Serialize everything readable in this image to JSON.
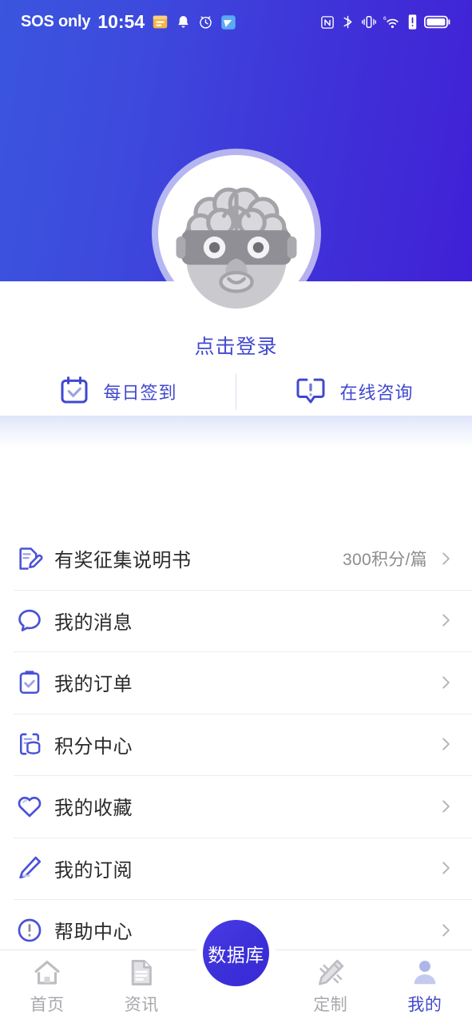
{
  "status_bar": {
    "carrier": "SOS only",
    "time": "10:54",
    "left_icons": [
      "calendar-icon",
      "bell-icon",
      "alarm-clock-icon",
      "weather-icon"
    ],
    "right_icons": [
      "nfc-icon",
      "bluetooth-icon",
      "vibrate-icon",
      "wifi-6-icon",
      "sim-alert-icon",
      "battery-icon"
    ]
  },
  "header": {
    "gradient_from": "#3b55de",
    "gradient_to": "#4020d6",
    "avatar_icon": "robot-brain-vr-avatar"
  },
  "profile": {
    "login_label": "点击登录",
    "actions": [
      {
        "label": "每日签到",
        "icon": "calendar-check-icon"
      },
      {
        "label": "在线咨询",
        "icon": "chat-alert-icon"
      }
    ]
  },
  "menu": {
    "items": [
      {
        "label": "有奖征集说明书",
        "value": "300积分/篇",
        "icon": "document-edit-icon"
      },
      {
        "label": "我的消息",
        "value": "",
        "icon": "chat-bubble-icon"
      },
      {
        "label": "我的订单",
        "value": "",
        "icon": "clipboard-check-icon"
      },
      {
        "label": "积分中心",
        "value": "",
        "icon": "document-coins-icon"
      },
      {
        "label": "我的收藏",
        "value": "",
        "icon": "heart-icon"
      },
      {
        "label": "我的订阅",
        "value": "",
        "icon": "pencil-icon"
      },
      {
        "label": "帮助中心",
        "value": "",
        "icon": "exclamation-circle-icon"
      }
    ]
  },
  "tabbar": {
    "items": [
      {
        "label": "首页",
        "icon": "home-icon",
        "active": false
      },
      {
        "label": "资讯",
        "icon": "news-document-icon",
        "active": false
      },
      {
        "label": "定制",
        "icon": "pencil-ruler-icon",
        "active": false
      },
      {
        "label": "我的",
        "icon": "person-icon",
        "active": true
      }
    ],
    "fab": {
      "label": "数据库",
      "icon": "database-fab"
    }
  },
  "colors": {
    "accent": "#4148cf",
    "accent_deep": "#3b2ad6",
    "text_primary": "#2b2b2b",
    "text_muted": "#8c8c8c",
    "tab_inactive": "#a8a8ad",
    "divider": "#ededf0"
  }
}
